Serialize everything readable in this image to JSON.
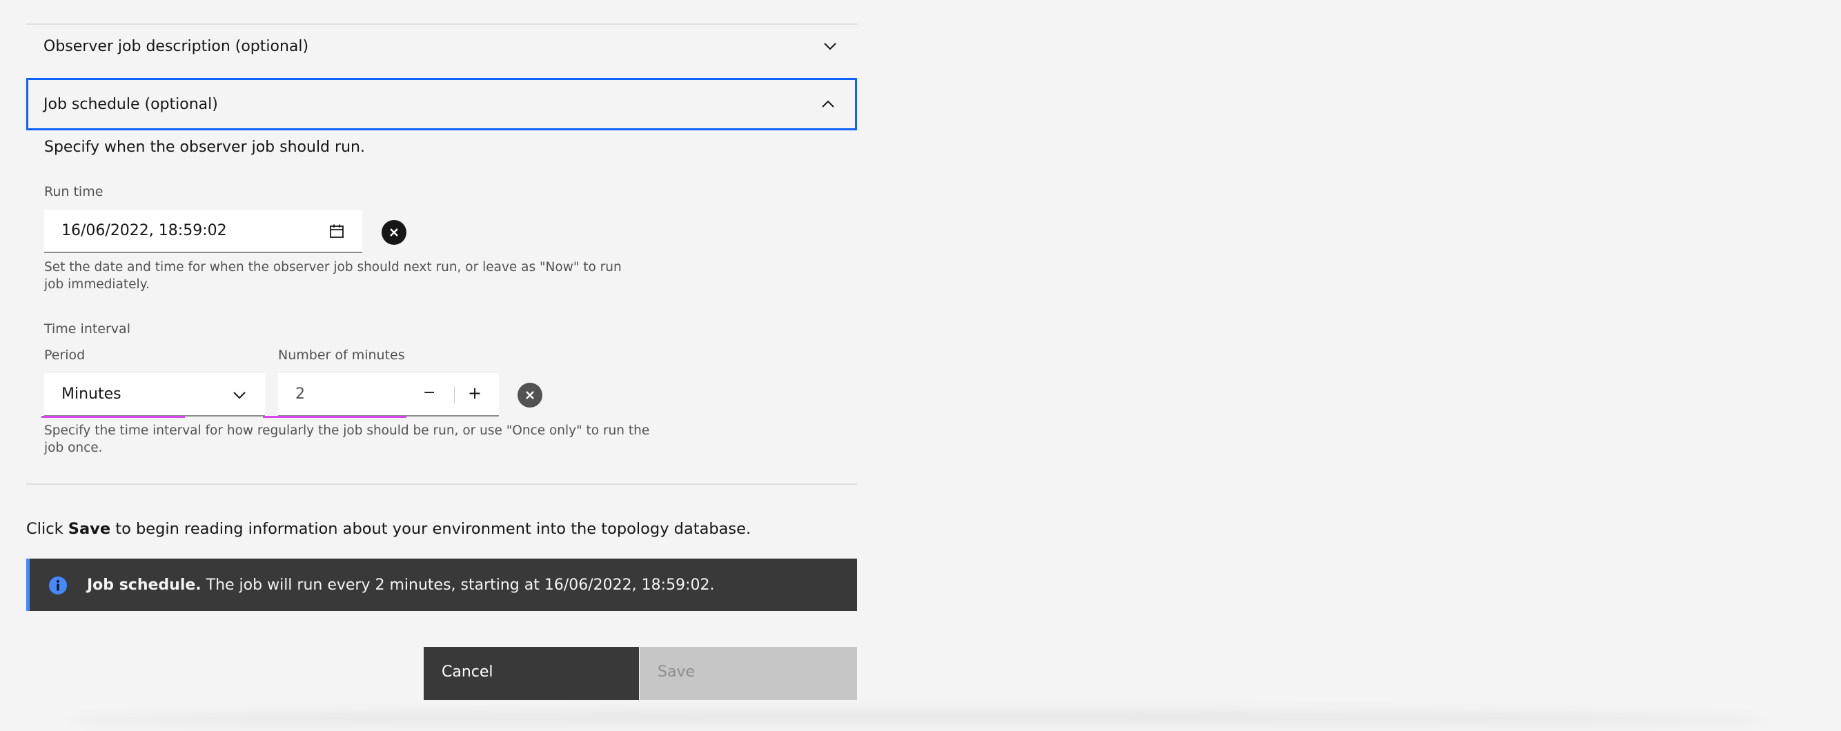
{
  "accordion": {
    "description_title": "Observer job description (optional)",
    "schedule_title": "Job schedule (optional)",
    "schedule_intro": "Specify when the observer job should run."
  },
  "run_time": {
    "label": "Run time",
    "value": "16/06/2022, 18:59:02",
    "helper": "Set the date and time for when the observer job should next run, or leave as \"Now\" to run job immediately."
  },
  "interval": {
    "label": "Time interval",
    "period_label": "Period",
    "period_value": "Minutes",
    "minutes_label": "Number of minutes",
    "minutes_value": "2",
    "decrement": "−",
    "increment": "+",
    "helper": "Specify the time interval for how regularly the job should be run, or use \"Once only\" to run the job once."
  },
  "instructions": {
    "prefix": "Click ",
    "bold": "Save",
    "suffix": " to begin reading information about your environment into the topology database."
  },
  "notification": {
    "title": "Job schedule.",
    "message": " The job will run every 2 minutes, starting at 16/06/2022, 18:59:02.",
    "icon": "info-icon",
    "accent": "#4589ff"
  },
  "buttons": {
    "cancel": "Cancel",
    "save": "Save"
  },
  "colors": {
    "focus": "#0f62fe",
    "highlight": "#d946ef"
  }
}
